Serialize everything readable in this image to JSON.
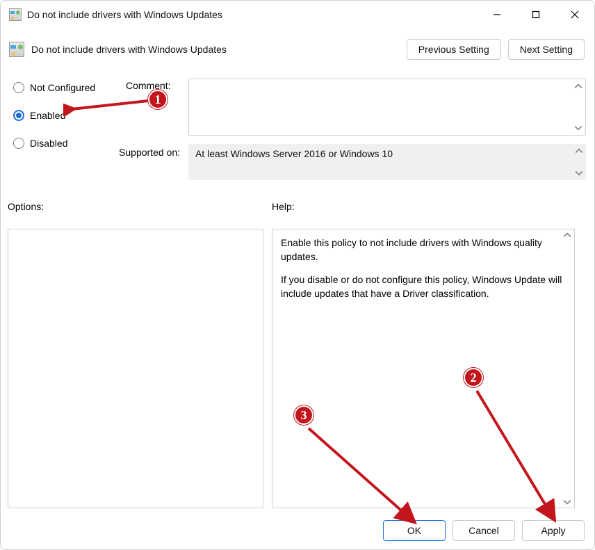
{
  "window": {
    "title": "Do not include drivers with Windows Updates"
  },
  "header": {
    "title": "Do not include drivers with Windows Updates",
    "prev": "Previous Setting",
    "next": "Next Setting"
  },
  "radios": {
    "not_configured": "Not Configured",
    "enabled": "Enabled",
    "disabled": "Disabled",
    "selected": "enabled"
  },
  "labels": {
    "comment": "Comment:",
    "supported": "Supported on:",
    "options": "Options:",
    "help": "Help:"
  },
  "supported_text": "At least Windows Server 2016 or Windows 10",
  "help_text_1": "Enable this policy to not include drivers with Windows quality updates.",
  "help_text_2": "If you disable or do not configure this policy, Windows Update will include updates that have a Driver classification.",
  "buttons": {
    "ok": "OK",
    "cancel": "Cancel",
    "apply": "Apply"
  },
  "annotations": {
    "b1": "1",
    "b2": "2",
    "b3": "3"
  }
}
